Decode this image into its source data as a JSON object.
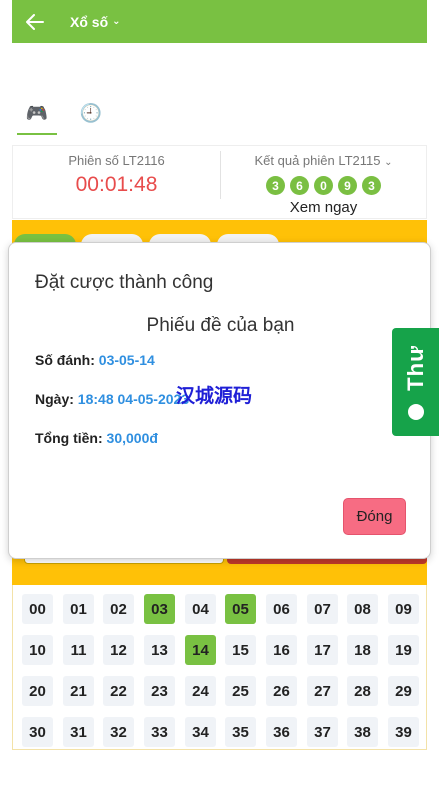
{
  "header": {
    "title": "Xổ số",
    "back_icon": "arrow-left-icon",
    "chevron_icon": "chevron-down-icon"
  },
  "tabs": [
    {
      "icon": "gamepad-icon",
      "glyph": "🎮",
      "active": true
    },
    {
      "icon": "clock-icon",
      "glyph": "🕘",
      "active": false
    }
  ],
  "session": {
    "current_label": "Phiên số LT2116",
    "countdown": "00:01:48",
    "result_label": "Kết quả phiên LT2115",
    "result_balls": [
      "3",
      "6",
      "0",
      "9",
      "3"
    ],
    "view_now": "Xem ngay"
  },
  "modal": {
    "title": "Đặt cược thành công",
    "heading": "Phiếu đề của bạn",
    "numbers_label": "Số đánh:",
    "numbers_value": "03-05-14",
    "date_label": "Ngày:",
    "date_value": "18:48 04-05-2023",
    "total_label": "Tổng tiền:",
    "total_value": "30,000đ",
    "close_label": "Đóng"
  },
  "watermark": "汉城源码",
  "side_tab": {
    "label": "Thư",
    "icon": "chat-icon"
  },
  "number_grid": {
    "rows": [
      [
        "00",
        "01",
        "02",
        "03",
        "04",
        "05",
        "06",
        "07",
        "08",
        "09"
      ],
      [
        "10",
        "11",
        "12",
        "13",
        "14",
        "15",
        "16",
        "17",
        "18",
        "19"
      ],
      [
        "20",
        "21",
        "22",
        "23",
        "24",
        "25",
        "26",
        "27",
        "28",
        "29"
      ],
      [
        "30",
        "31",
        "32",
        "33",
        "34",
        "35",
        "36",
        "37",
        "38",
        "39"
      ]
    ],
    "selected": [
      "03",
      "05",
      "14"
    ]
  },
  "colors": {
    "primary_green": "#79c142",
    "accent_yellow": "#ffc107",
    "timer_red": "#e84c4c",
    "link_blue": "#2f8fe0",
    "close_pink": "#f76c83"
  }
}
